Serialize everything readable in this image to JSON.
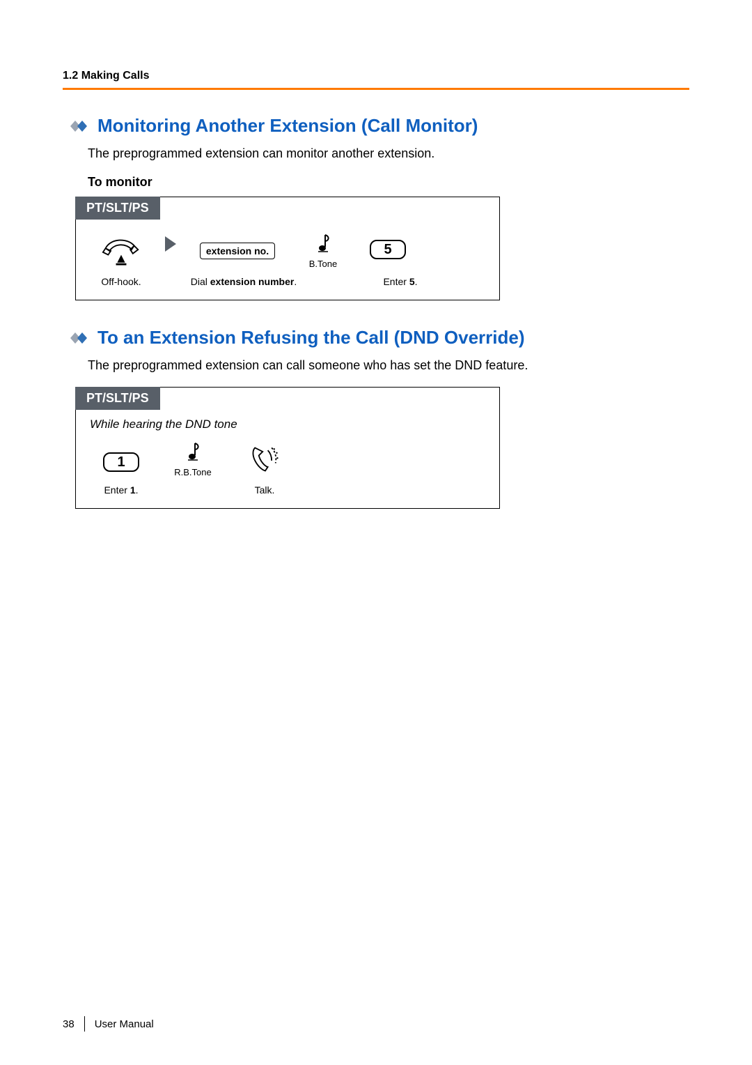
{
  "runningHead": "1.2 Making Calls",
  "section1": {
    "title": "Monitoring Another Extension (Call Monitor)",
    "intro": "The preprogrammed extension can monitor another extension.",
    "subheading": "To monitor",
    "tab": "PT/SLT/PS",
    "steps": {
      "offhook": "Off-hook.",
      "extBox": "extension no.",
      "dial_pre": "Dial ",
      "dial_bold": "extension number",
      "dial_post": ".",
      "btone": "B.Tone",
      "key": "5",
      "enter_pre": "Enter ",
      "enter_bold": "5",
      "enter_post": "."
    }
  },
  "section2": {
    "title": "To an Extension Refusing the Call (DND Override)",
    "intro": "The preprogrammed extension can call someone who has set the DND feature.",
    "tab": "PT/SLT/PS",
    "noteItalic": "While hearing the DND tone",
    "steps": {
      "key": "1",
      "enter_pre": "Enter ",
      "enter_bold": "1",
      "enter_post": ".",
      "rbtone": "R.B.Tone",
      "talk": "Talk."
    }
  },
  "footer": {
    "pageNumber": "38",
    "docTitle": "User Manual"
  }
}
